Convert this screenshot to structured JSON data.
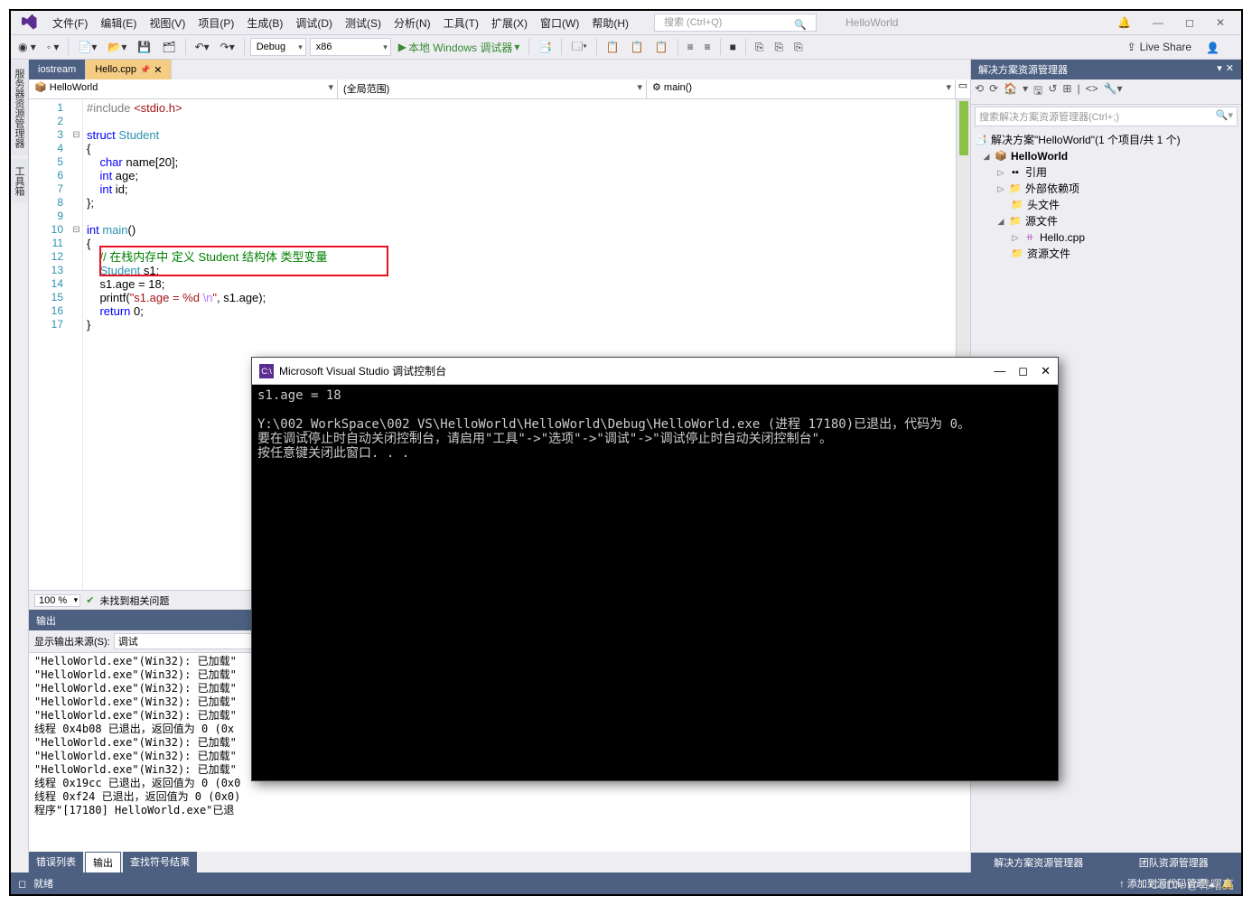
{
  "menu": [
    "文件(F)",
    "编辑(E)",
    "视图(V)",
    "项目(P)",
    "生成(B)",
    "调试(D)",
    "测试(S)",
    "分析(N)",
    "工具(T)",
    "扩展(X)",
    "窗口(W)",
    "帮助(H)"
  ],
  "search_placeholder": "搜索 (Ctrl+Q)",
  "project_name": "HelloWorld",
  "toolbar": {
    "config": "Debug",
    "platform": "x86",
    "debugger": "本地 Windows 调试器",
    "liveshare": "Live Share"
  },
  "leftTabs": [
    "服务器资源管理器",
    "工具箱"
  ],
  "fileTabs": {
    "inactive": "iostream",
    "active": "Hello.cpp"
  },
  "navcombos": [
    "HelloWorld",
    "(全局范围)",
    "main()"
  ],
  "zoom": "100 %",
  "noissues": "未找到相关问题",
  "code": {
    "l1a": "#include",
    "l1b": "<stdio.h>",
    "l3a": "struct",
    "l3b": "Student",
    "l4": "{",
    "l5a": "char",
    "l5b": " name[20];",
    "l6a": "int",
    "l6b": " age;",
    "l7a": "int",
    "l7b": " id;",
    "l8": "};",
    "l10a": "int",
    "l10b": "main",
    "l10c": "()",
    "l11": "{",
    "l12": "// 在栈内存中 定义 Student 结构体 类型变量",
    "l13a": "Student",
    "l13b": " s1;",
    "l14": "s1.age = 18;",
    "l15a": "printf(",
    "l15b": "\"s1.age = %d ",
    "l15c": "\\n",
    "l15d": "\"",
    "l15e": ", s1.age);",
    "l16a": "return",
    "l16b": " 0;",
    "l17": "}"
  },
  "output": {
    "title": "输出",
    "source_label": "显示输出来源(S):",
    "source": "调试",
    "lines": [
      "\"HelloWorld.exe\"(Win32): 已加载\"",
      "\"HelloWorld.exe\"(Win32): 已加载\"",
      "\"HelloWorld.exe\"(Win32): 已加载\"",
      "\"HelloWorld.exe\"(Win32): 已加载\"",
      "\"HelloWorld.exe\"(Win32): 已加载\"",
      "线程 0x4b08 已退出，返回值为 0 (0x",
      "\"HelloWorld.exe\"(Win32): 已加载\"",
      "\"HelloWorld.exe\"(Win32): 已加载\"",
      "\"HelloWorld.exe\"(Win32): 已加载\"",
      "线程 0x19cc 已退出，返回值为 0 (0x0",
      "线程 0xf24 已退出，返回值为 0 (0x0)",
      "程序\"[17180] HelloWorld.exe\"已退"
    ]
  },
  "bottomTabs": [
    "错误列表",
    "输出",
    "查找符号结果"
  ],
  "solution": {
    "title": "解决方案资源管理器",
    "search": "搜索解决方案资源管理器(Ctrl+;)",
    "root": "解决方案\"HelloWorld\"(1 个项目/共 1 个)",
    "proj": "HelloWorld",
    "refs": "引用",
    "ext": "外部依赖项",
    "hdr": "头文件",
    "src": "源文件",
    "file": "Hello.cpp",
    "res": "资源文件",
    "bt1": "解决方案资源管理器",
    "bt2": "团队资源管理器"
  },
  "status": {
    "ready": "就绪",
    "addSrc": "添加到源代码管理"
  },
  "console": {
    "title": "Microsoft Visual Studio 调试控制台",
    "body": "s1.age = 18\n\nY:\\002_WorkSpace\\002_VS\\HelloWorld\\HelloWorld\\Debug\\HelloWorld.exe (进程 17180)已退出，代码为 0。\n要在调试停止时自动关闭控制台，请启用\"工具\"->\"选项\"->\"调试\"->\"调试停止时自动关闭控制台\"。\n按任意键关闭此窗口. . ."
  },
  "watermark": "CSDN @韩曙亮"
}
